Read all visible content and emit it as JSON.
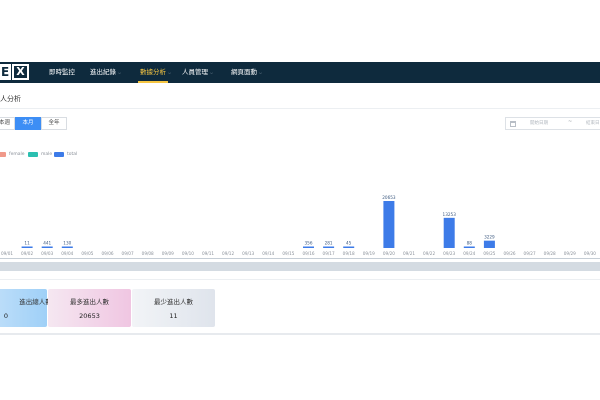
{
  "navbar": {
    "logo_text": "E",
    "logo_mark": "X",
    "items": [
      {
        "label": "即時監控",
        "has_caret": false,
        "active": false
      },
      {
        "label": "進出紀錄",
        "has_caret": true,
        "active": false
      },
      {
        "label": "數據分析",
        "has_caret": true,
        "active": true
      },
      {
        "label": "人員管理",
        "has_caret": true,
        "active": false
      },
      {
        "label": "網頁面動",
        "has_caret": true,
        "active": false
      }
    ],
    "caret_glyph": "⌵",
    "background": "#0e2a3d",
    "active_color": "#f5c542"
  },
  "page": {
    "title": "人分析"
  },
  "range_buttons": [
    {
      "label": "本週",
      "active": false
    },
    {
      "label": "本月",
      "active": true
    },
    {
      "label": "全年",
      "active": false
    }
  ],
  "date_range": {
    "start_placeholder": "開始日期",
    "separator": "~",
    "end_placeholder": "結束日"
  },
  "legend": [
    {
      "name": "female",
      "color": "#f0998a"
    },
    {
      "name": "male",
      "color": "#2bbfb0"
    },
    {
      "name": "total",
      "color": "#3d7be8"
    }
  ],
  "chart_data": {
    "type": "bar",
    "categories": [
      "09/01",
      "09/02",
      "09/03",
      "09/04",
      "09/05",
      "09/06",
      "09/07",
      "09/08",
      "09/09",
      "09/10",
      "09/11",
      "09/12",
      "09/13",
      "09/14",
      "09/15",
      "09/16",
      "09/17",
      "09/18",
      "09/19",
      "09/20",
      "09/21",
      "09/22",
      "09/23",
      "09/24",
      "09/25",
      "09/26",
      "09/27",
      "09/28",
      "09/29",
      "09/30"
    ],
    "series": [
      {
        "name": "total",
        "values": [
          null,
          11,
          441,
          130,
          0,
          0,
          0,
          0,
          0,
          0,
          0,
          0,
          0,
          0,
          0,
          356,
          281,
          45,
          0,
          20653,
          0,
          0,
          13253,
          88,
          3229,
          0,
          0,
          0,
          0,
          0
        ]
      }
    ],
    "data_labels": {
      "2": "11",
      "3": "441",
      "4": "130",
      "16": "356",
      "17": "281",
      "18": "45",
      "20": "20653",
      "23": "13253",
      "24": "88",
      "25": "3229"
    },
    "bar_color": "#3d7be8",
    "ylim": [
      0,
      20653
    ],
    "grid": false,
    "legend_position": "top-left",
    "tick_labels": [
      "09/01",
      "09/02",
      "09/03",
      "09/04",
      "09/05",
      "09/06",
      "09/07",
      "09/08",
      "09/09",
      "09/10",
      "09/11",
      "09/12",
      "09/13",
      "09/14",
      "09/15",
      "09/16",
      "09/17",
      "09/18",
      "09/19",
      "09/20",
      "09/21",
      "09/22",
      "09/23",
      "09/24",
      "09/25",
      "09/26",
      "09/27",
      "09/28",
      "09/29",
      "09/30"
    ]
  },
  "stats": {
    "total": {
      "label": "進出總人數",
      "value": "0"
    },
    "max": {
      "label": "最多進出人數",
      "value": "20653"
    },
    "min": {
      "label": "最少進出人數",
      "value": "11"
    }
  }
}
